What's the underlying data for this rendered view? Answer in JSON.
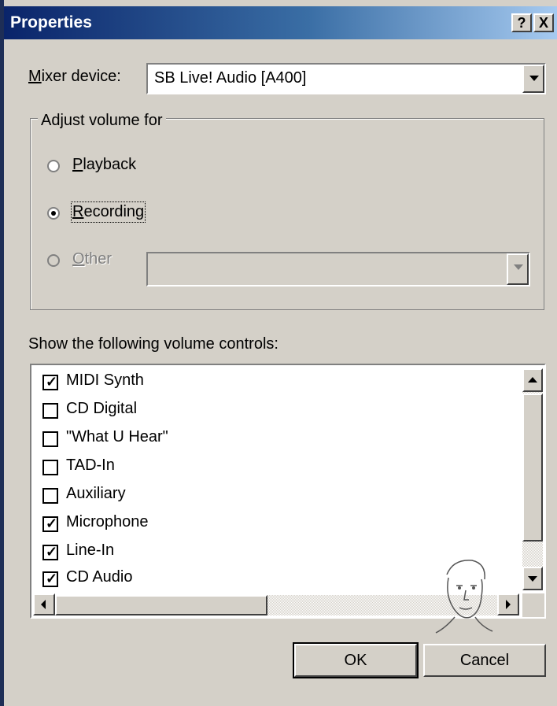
{
  "window": {
    "title": "Properties",
    "help_label": "?",
    "close_label": "X"
  },
  "mixer": {
    "label": "Mixer device:",
    "value": "SB Live! Audio [A400]"
  },
  "adjust": {
    "group_title": "Adjust volume for",
    "options": [
      {
        "label": "Playback",
        "selected": false,
        "disabled": false
      },
      {
        "label": "Recording",
        "selected": true,
        "disabled": false
      },
      {
        "label": "Other",
        "selected": false,
        "disabled": true
      }
    ],
    "other_value": ""
  },
  "controls": {
    "label": "Show the following volume controls:",
    "items": [
      {
        "label": "MIDI Synth",
        "checked": true
      },
      {
        "label": "CD Digital",
        "checked": false
      },
      {
        "label": "\"What U Hear\"",
        "checked": false
      },
      {
        "label": "TAD-In",
        "checked": false
      },
      {
        "label": "Auxiliary",
        "checked": false
      },
      {
        "label": "Microphone",
        "checked": true
      },
      {
        "label": "Line-In",
        "checked": true
      },
      {
        "label": "CD Audio",
        "checked": true
      }
    ]
  },
  "buttons": {
    "ok": "OK",
    "cancel": "Cancel"
  },
  "icons": {
    "scroll_up": "triangle-up",
    "scroll_down": "triangle-down",
    "scroll_left": "triangle-left",
    "scroll_right": "triangle-right",
    "checkmark": "✓",
    "dropdown": "triangle-down"
  }
}
